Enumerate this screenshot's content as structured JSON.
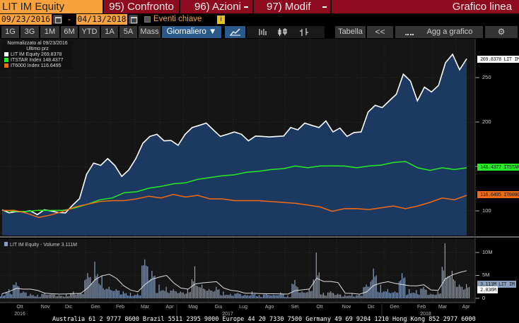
{
  "header": {
    "security": "LIT IM Equity",
    "compare": "95) Confronto",
    "actions": "96) Azioni",
    "edit": "97) Modif",
    "chart_type": "Grafico linea"
  },
  "dates": {
    "start": "09/23/2016",
    "separator": "-",
    "end": "04/13/2018",
    "key_events": "Eventi chiave",
    "info": "i"
  },
  "periods": [
    "1G",
    "3G",
    "1M",
    "6M",
    "YTD",
    "1A",
    "5A",
    "Mass"
  ],
  "frequency": "Giornaliero ▼",
  "toolbar": {
    "table": "Tabella",
    "collapse": "<<",
    "add_to_chart": "Agg a grafico"
  },
  "legend": {
    "title": "Normalizzato al 09/23/2016",
    "subtitle": "Ultimo prz",
    "items": [
      {
        "label": "LIT IM Equity  269.8378",
        "color": "#ffffff"
      },
      {
        "label": "ITSTAR Index  148.4377",
        "color": "#22ee22"
      },
      {
        "label": "IT6000 Index  116.6495",
        "color": "#f26a12"
      }
    ]
  },
  "tags": {
    "lit": "269.8378 LIT IM",
    "itstar": "148.4377 ITSTAR",
    "it6000": "116.6495 IT6000",
    "vol": "3.111M LIT IM",
    "vol_avg": "2.036M"
  },
  "volume_legend": "LIT IM Equity - Volume 3.111M",
  "footer": "Australia 61 2 9777 8600 Brazil 5511 2395 9000 Europe 44 20 7330 7500 Germany 49 69 9204 1210 Hong Kong 852 2977 6000",
  "chart_data": [
    {
      "type": "line",
      "title": "Normalizzato al 09/23/2016",
      "ylim": [
        75,
        285
      ],
      "yticks": [
        "250",
        "200",
        "100"
      ],
      "ytick_values": [
        250,
        200,
        100
      ],
      "x_months": [
        "Ott",
        "Nov",
        "Dic",
        "Gen",
        "Feb",
        "Mar",
        "Apr",
        "Mag",
        "Giu",
        "Lug",
        "Ago",
        "Set",
        "Ott",
        "Nov",
        "Dic",
        "Gen",
        "Feb",
        "Mar",
        "Apr"
      ],
      "x_years": [
        "2016",
        "2017",
        "2018"
      ],
      "series": [
        {
          "name": "LIT IM Equity",
          "color": "#ffffff",
          "values": [
            100,
            99,
            98,
            100,
            99,
            97,
            100,
            101,
            97,
            99,
            105,
            115,
            140,
            155,
            150,
            160,
            150,
            140,
            145,
            160,
            175,
            185,
            185,
            180,
            178,
            175,
            185,
            195,
            195,
            200,
            190,
            185,
            185,
            190,
            185,
            180,
            183,
            185,
            182,
            185,
            183,
            195,
            190,
            200,
            195,
            195,
            200,
            190,
            192,
            185,
            187,
            190,
            210,
            220,
            215,
            225,
            230,
            255,
            245,
            225,
            238,
            235,
            240,
            268,
            275,
            260,
            270
          ]
        },
        {
          "name": "ITSTAR Index",
          "color": "#22ee22",
          "values": [
            100,
            100,
            99,
            101,
            100,
            101,
            103,
            108,
            112,
            115,
            120,
            122,
            125,
            128,
            130,
            132,
            135,
            138,
            139,
            141,
            143,
            145,
            146,
            148,
            150,
            149,
            150,
            151,
            150,
            149,
            150,
            152,
            154,
            156,
            148,
            146,
            148,
            147,
            148
          ]
        },
        {
          "name": "IT6000 Index",
          "color": "#f26a12",
          "values": [
            100,
            101,
            97,
            93,
            95,
            100,
            104,
            108,
            110,
            112,
            111,
            114,
            116,
            115,
            118,
            116,
            117,
            114,
            113,
            112,
            111,
            112,
            110,
            110,
            108,
            107,
            104,
            100,
            102,
            103,
            101,
            104,
            105,
            103,
            105,
            110,
            114,
            113,
            117
          ]
        }
      ]
    },
    {
      "type": "bar",
      "title": "LIT IM Equity - Volume 3.111M",
      "ylim": [
        0,
        13
      ],
      "yticks": [
        "10M",
        "5M",
        "0"
      ],
      "ytick_values": [
        10,
        5,
        0
      ],
      "series": [
        {
          "name": "Volume (M)",
          "values": [
            1,
            2,
            3.5,
            1.5,
            1,
            0.8,
            1.2,
            1,
            0.7,
            0.9,
            1.5,
            1.2,
            5.5,
            8,
            5,
            2.5,
            2,
            1.5,
            1.2,
            1,
            8.5,
            6,
            3,
            2.5,
            2,
            1.5,
            2,
            7,
            3,
            2,
            2.5,
            1.5,
            1,
            1.2,
            0.8,
            1.5,
            0.7,
            1,
            0.8,
            1.3,
            0.6,
            4,
            1.5,
            2,
            10,
            1.2,
            1.5,
            1,
            0.8,
            1,
            0.8,
            3,
            6.5,
            3,
            2,
            1.5,
            5.5,
            2,
            1.8,
            2.5,
            1,
            1.5,
            12,
            6,
            3,
            3.1
          ]
        }
      ]
    }
  ]
}
